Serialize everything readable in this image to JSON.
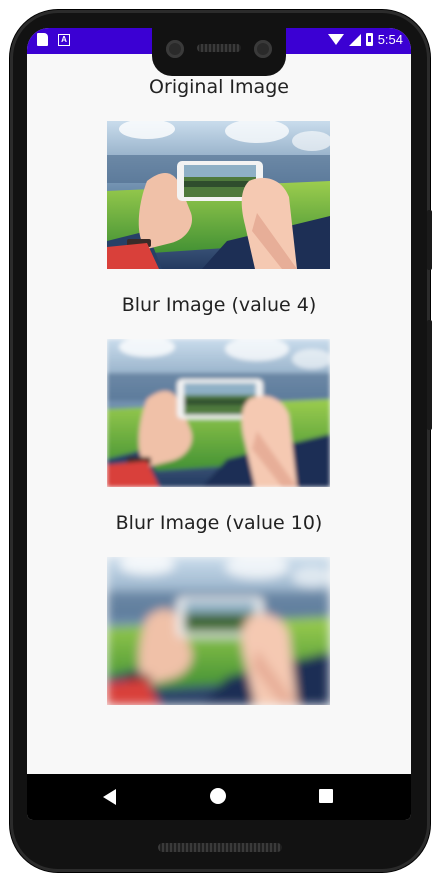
{
  "status_bar": {
    "time": "5:54"
  },
  "sections": [
    {
      "label": "Original Image",
      "blur_value": 0
    },
    {
      "label": "Blur Image (value 4)",
      "blur_value": 4
    },
    {
      "label": "Blur Image (value 10)",
      "blur_value": 10
    }
  ],
  "colors": {
    "status_bar": "#3b00d3",
    "background": "#f8f8f8",
    "nav_bar": "#000000"
  },
  "icons": {
    "status_left": [
      "sd-card-icon",
      "a-notification-icon"
    ],
    "status_right": [
      "wifi-icon",
      "signal-icon",
      "battery-icon"
    ],
    "navigation": [
      "back-icon",
      "home-icon",
      "recents-icon"
    ]
  }
}
